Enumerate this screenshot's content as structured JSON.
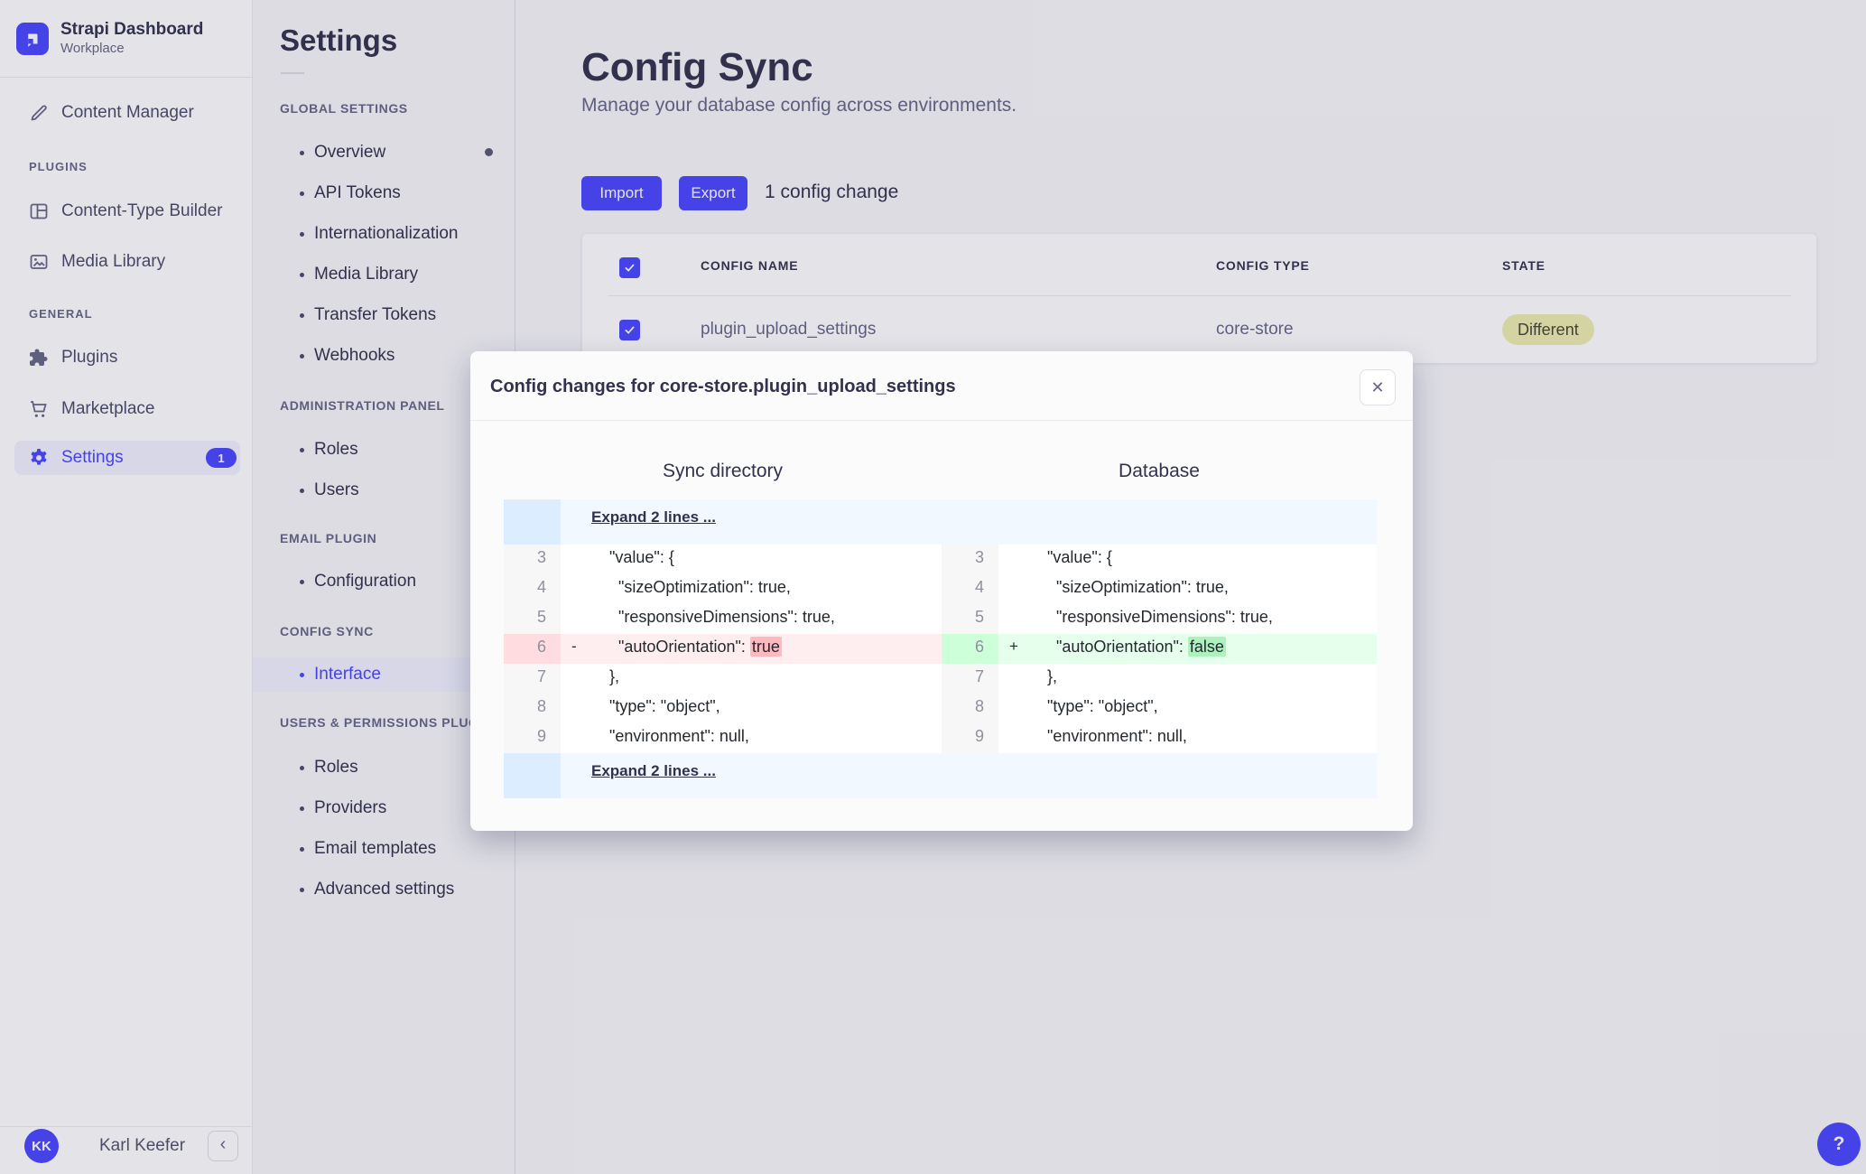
{
  "colors": {
    "accent": "#4945FF",
    "selected_bg": "#F0F0FF",
    "badge_different_bg": "#EDEDAF",
    "diff_removed_line": "#FFEEF0",
    "diff_removed_gutter": "#FFDCE0",
    "diff_removed_word": "#FDB8C0",
    "diff_added_line": "#E6FFED",
    "diff_added_gutter": "#CDFFD8",
    "diff_added_word": "#ACF2BD",
    "diff_fold_bg": "#F1F8FF",
    "diff_fold_gutter": "#DBEDFF"
  },
  "sidebar": {
    "brand": {
      "title": "Strapi Dashboard",
      "subtitle": "Workplace"
    },
    "content_manager": "Content Manager",
    "sections": [
      {
        "label": "PLUGINS",
        "items": [
          {
            "label": "Content-Type Builder"
          },
          {
            "label": "Media Library"
          }
        ]
      },
      {
        "label": "GENERAL",
        "items": [
          {
            "label": "Plugins"
          },
          {
            "label": "Marketplace"
          },
          {
            "label": "Settings",
            "badge": "1"
          }
        ]
      }
    ],
    "user": {
      "initials": "KK",
      "name": "Karl Keefer"
    },
    "icons": {
      "collapse": "‹"
    }
  },
  "settings_nav": {
    "title": "Settings",
    "groups": [
      {
        "label": "GLOBAL SETTINGS",
        "items": [
          "Overview",
          "API Tokens",
          "Internationalization",
          "Media Library",
          "Transfer Tokens",
          "Webhooks"
        ]
      },
      {
        "label": "ADMINISTRATION PANEL",
        "items": [
          "Roles",
          "Users"
        ]
      },
      {
        "label": "EMAIL PLUGIN",
        "items": [
          "Configuration"
        ]
      },
      {
        "label": "CONFIG SYNC",
        "items": [
          "Interface"
        ]
      },
      {
        "label": "USERS & PERMISSIONS PLUGIN",
        "items": [
          "Roles",
          "Providers",
          "Email templates",
          "Advanced settings"
        ]
      }
    ],
    "active_item": "Interface"
  },
  "main": {
    "title": "Config Sync",
    "subtitle": "Manage your database config across environments.",
    "import_label": "Import",
    "export_label": "Export",
    "summary": "1 config change",
    "table": {
      "headers": [
        "CONFIG NAME",
        "CONFIG TYPE",
        "STATE"
      ],
      "rows": [
        {
          "name": "plugin_upload_settings",
          "type": "core-store",
          "state": "Different"
        }
      ]
    }
  },
  "modal": {
    "title": "Config changes for core-store.plugin_upload_settings",
    "close_icon": "✕",
    "left_title": "Sync directory",
    "right_title": "Database",
    "expand_top": "Expand 2 lines ...",
    "expand_bottom": "Expand 2 lines ...",
    "diff": {
      "lines": [
        {
          "num": "3",
          "text": "  \"value\": {"
        },
        {
          "num": "4",
          "text": "    \"sizeOptimization\": true,"
        },
        {
          "num": "5",
          "text": "    \"responsiveDimensions\": true,"
        },
        {
          "num": "6",
          "left": {
            "marker": "-",
            "text": "    \"autoOrientation\": ",
            "word": "true"
          },
          "right": {
            "marker": "+",
            "text": "    \"autoOrientation\": ",
            "word": "false"
          }
        },
        {
          "num": "7",
          "text": "  },"
        },
        {
          "num": "8",
          "text": "  \"type\": \"object\","
        },
        {
          "num": "9",
          "text": "  \"environment\": null,"
        }
      ]
    }
  },
  "help": {
    "label": "?"
  }
}
